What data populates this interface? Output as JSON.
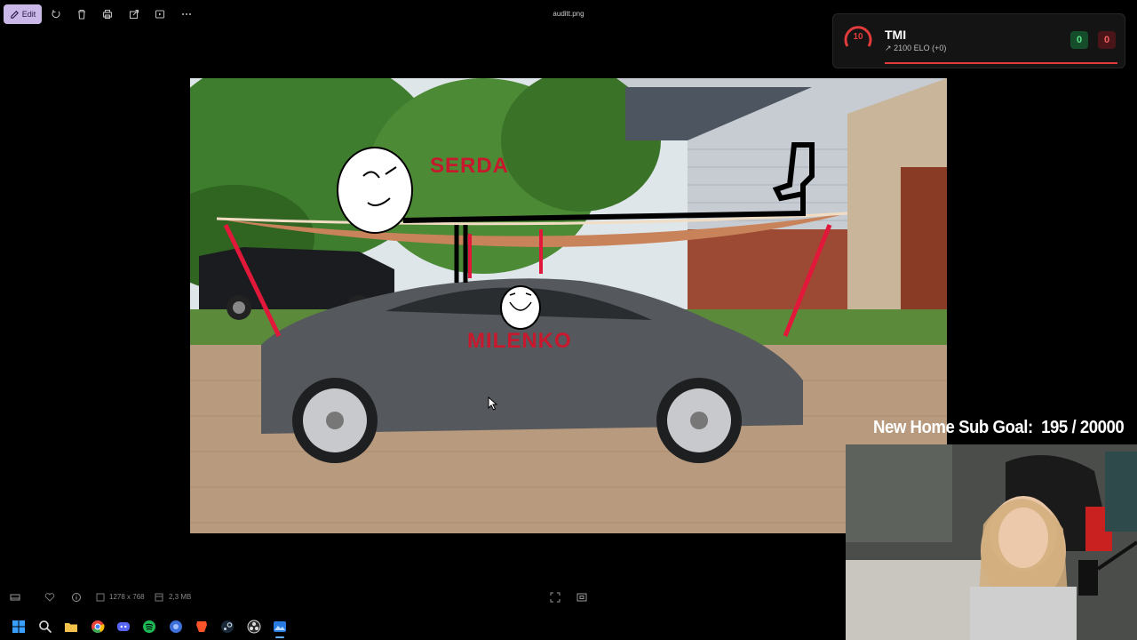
{
  "toolbar": {
    "edit_label": "Edit",
    "file_title": "auditt.png",
    "buttons": [
      "rotate-icon",
      "delete-icon",
      "print-icon",
      "share-icon",
      "slideshow-icon",
      "more-icon"
    ]
  },
  "image": {
    "label_top": "SERDA",
    "label_car": "MILENKO"
  },
  "overlay": {
    "rank": "10",
    "name": "TMI",
    "elo": "2100 ELO (+0)",
    "score_wins": "0",
    "score_losses": "0",
    "progress": 1.0,
    "accent": "#e23b3b"
  },
  "subgoal": {
    "label": "New Home Sub Goal:",
    "value": "195 / 20000"
  },
  "statusbar": {
    "dimensions": "1278 x 768",
    "file_size": "2,3 MB"
  },
  "taskbar": {
    "icons": [
      "windows-start-icon",
      "search-icon",
      "file-explorer-icon",
      "chrome-icon",
      "discord-icon",
      "spotify-icon",
      "app-icon",
      "brave-icon",
      "steam-icon",
      "obs-icon",
      "photos-icon"
    ]
  }
}
